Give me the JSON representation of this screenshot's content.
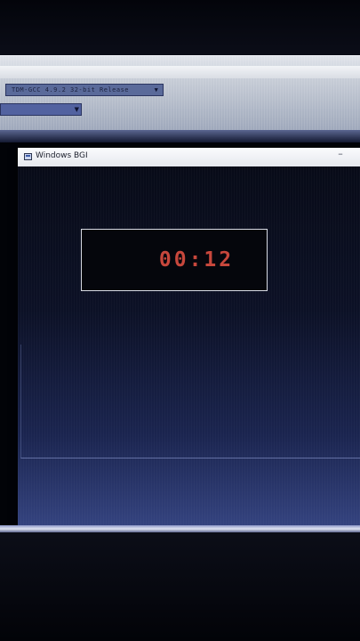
{
  "ide": {
    "compiler_select": "TDM-GCC 4.9.2 32-bit Release",
    "small_select": ""
  },
  "bgi_window": {
    "title": "Windows BGI",
    "minimize_glyph": "–",
    "timer_text": "00:12"
  },
  "colors": {
    "timer": "#c7473c",
    "timer_border": "#d8dbe4",
    "titlebar": "#f2f3f6",
    "canvas": "#0c1126"
  },
  "icons": {
    "app_icon": "window-icon",
    "compiler_dropdown": "chevron-down-icon",
    "small_dropdown": "chevron-down-icon",
    "minimize": "minimize-icon"
  }
}
